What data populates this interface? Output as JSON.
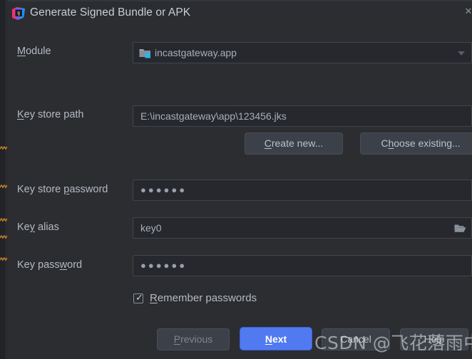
{
  "window": {
    "title": "Generate Signed Bundle or APK",
    "app_icon": "intellij-idea-icon",
    "close_label": "✕"
  },
  "form": {
    "module": {
      "label": "Module",
      "mnemonic": "M",
      "label_rest": "odule",
      "value": "incastgateway.app",
      "icon": "module-folder-icon",
      "arrow_icon": "chevron-down-icon"
    },
    "key_store_path": {
      "label_mn": "K",
      "label_rest": "ey store path",
      "value": "E:\\incastgateway\\app\\123456.jks"
    },
    "create_new_button": {
      "mn": "C",
      "rest": "reate new..."
    },
    "choose_existing_button": {
      "pre": "C",
      "mn": "h",
      "rest": "oose existing..."
    },
    "key_store_password": {
      "pre": "Key store ",
      "mn": "p",
      "rest": "assword",
      "value": "●●●●●●"
    },
    "key_alias": {
      "pre": "Ke",
      "mn": "y",
      "rest": " alias",
      "value": "key0",
      "browse_icon": "open-folder-icon"
    },
    "key_password": {
      "pre": "Key pass",
      "mn": "w",
      "rest": "ord",
      "value": "●●●●●●"
    },
    "remember_passwords": {
      "mn": "R",
      "rest": "emember passwords",
      "checked": true,
      "check_glyph": "✓"
    }
  },
  "footer": {
    "previous": {
      "mn": "P",
      "rest": "revious"
    },
    "next": {
      "mn": "N",
      "rest": "ext"
    },
    "cancel": "Cancel",
    "help": "Help"
  },
  "watermark": "CSDN @飞花落雨中",
  "colors": {
    "dialog_bg": "#2b2d31",
    "field_bg": "#26282d",
    "field_border": "#42454c",
    "button_bg": "#3c4049",
    "primary_blue": "#5179f0",
    "text": "#b5bac2",
    "squiggle_orange": "#c07a22"
  }
}
